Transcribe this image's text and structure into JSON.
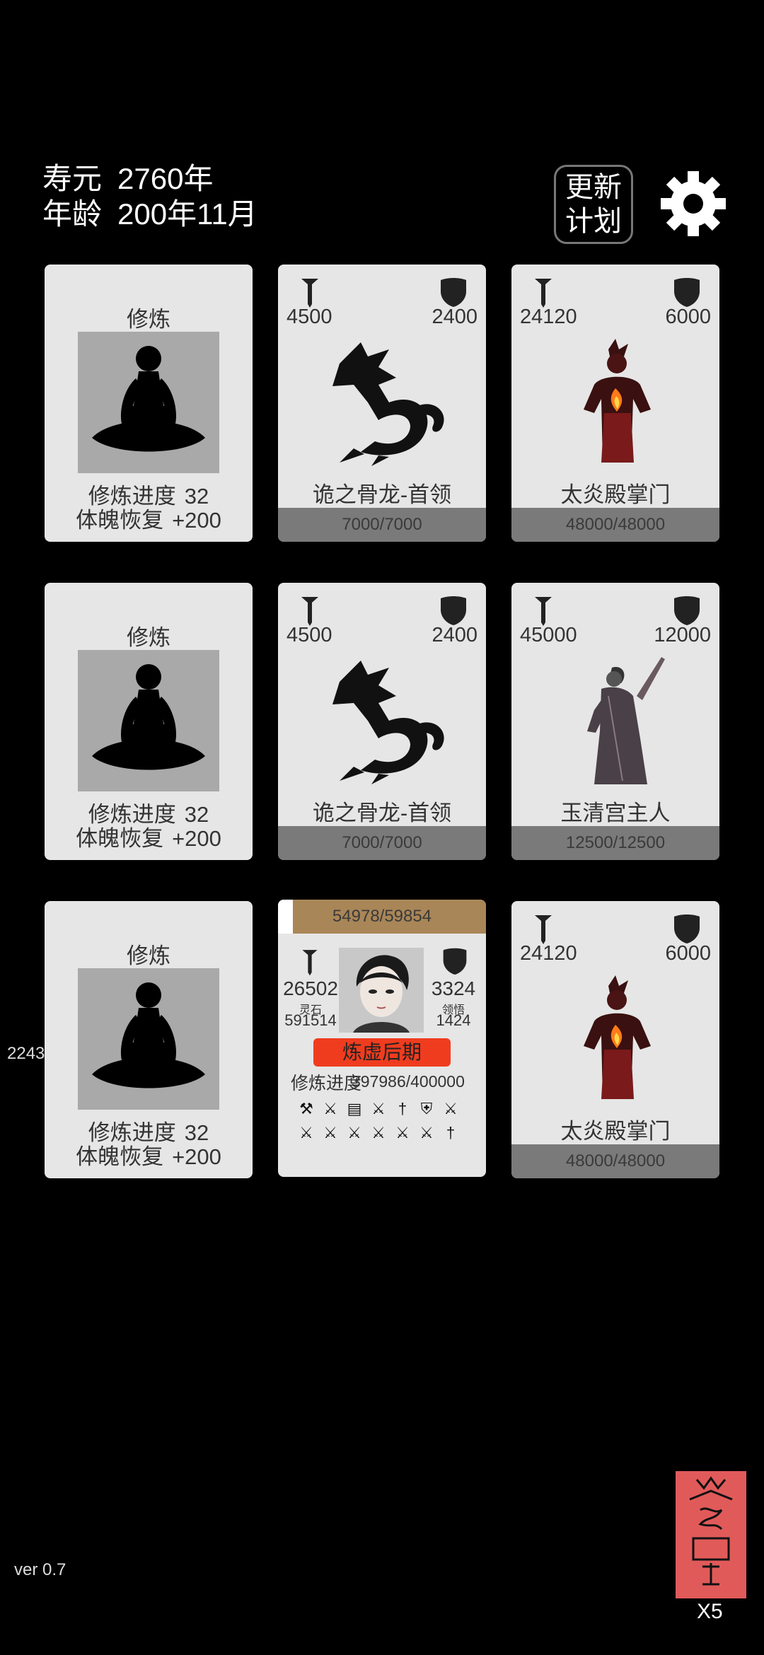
{
  "hud": {
    "lifespan_label": "寿元",
    "lifespan_value": "2760年",
    "age_label": "年龄",
    "age_value": "200年11月",
    "update_line1": "更新",
    "update_line2": "计划"
  },
  "train_card": {
    "title": "修炼",
    "progress_label": "修炼进度",
    "progress_value": "32",
    "recover_label": "体魄恢复",
    "recover_value": "+200"
  },
  "enemies": [
    {
      "atk": "4500",
      "def": "2400",
      "name": "诡之骨龙-首领",
      "hp": "7000/7000",
      "icon": "dragon-icon"
    },
    {
      "atk": "24120",
      "def": "6000",
      "name": "太炎殿掌门",
      "hp": "48000/48000",
      "icon": "flame-demon-icon"
    },
    {
      "atk": "4500",
      "def": "2400",
      "name": "诡之骨龙-首领",
      "hp": "7000/7000",
      "icon": "dragon-icon"
    },
    {
      "atk": "45000",
      "def": "12000",
      "name": "玉清宫主人",
      "hp": "12500/12500",
      "icon": "sword-master-icon"
    },
    {
      "atk": "24120",
      "def": "6000",
      "name": "太炎殿掌门",
      "hp": "48000/48000",
      "icon": "flame-demon-icon"
    }
  ],
  "player": {
    "xp": "54978/59854",
    "xp_fraction": 0.07,
    "atk": "26502",
    "def": "3324",
    "stone_label": "灵石",
    "stone_value": "591514",
    "insight_label": "领悟",
    "insight_value": "1424",
    "realm": "炼虚后期",
    "progress_label": "修炼进度",
    "progress_value": "397986/400000",
    "items": [
      "ax",
      "sword",
      "scroll",
      "sword",
      "dagger",
      "shield",
      "sword",
      "sword",
      "sword",
      "sword",
      "sword",
      "sword",
      "sword",
      "dagger"
    ]
  },
  "side_number": "2243",
  "version": "ver 0.7",
  "talisman_count": "X5",
  "colors": {
    "card": "#e6e6e6",
    "hp_bar": "#7a7a7a",
    "xp_bar": "#a98657",
    "realm": "#f03c1e",
    "talisman": "#e15a5a"
  }
}
